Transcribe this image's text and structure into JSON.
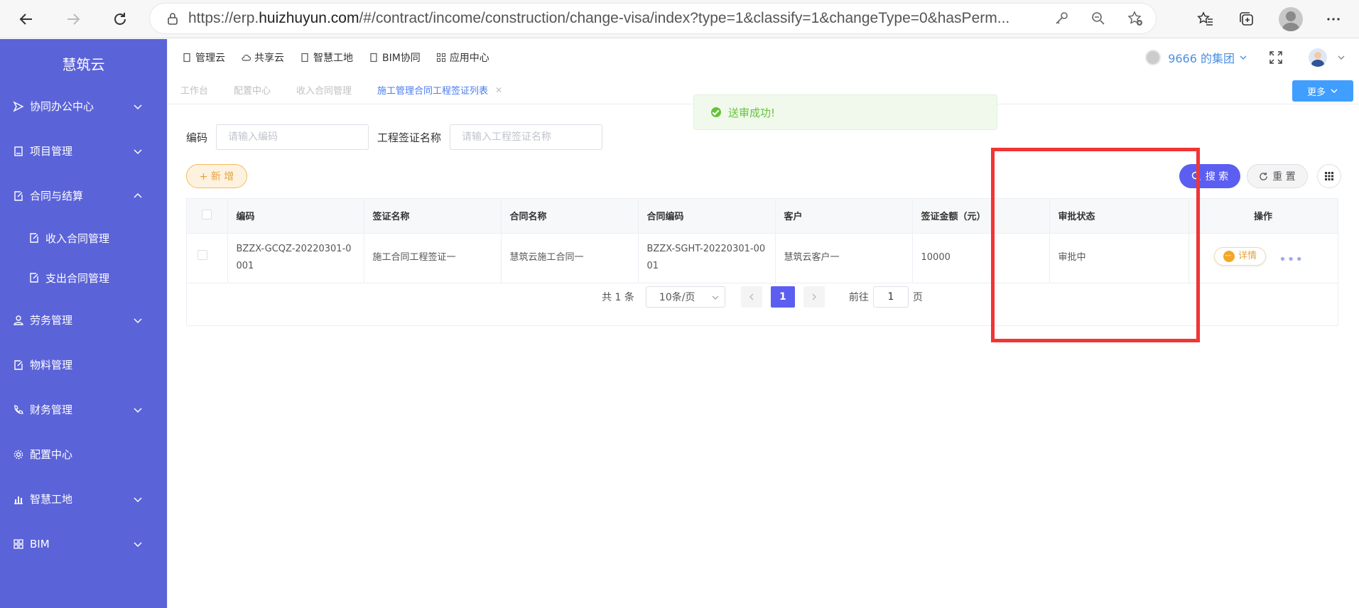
{
  "browser": {
    "url_prefix": "https://erp.",
    "url_domain": "huizhuyun.com",
    "url_rest": "/#/contract/income/construction/change-visa/index?type=1&classify=1&changeType=0&hasPerm..."
  },
  "sidebar": {
    "brand": "慧筑云",
    "items": [
      {
        "label": "协同办公中心"
      },
      {
        "label": "项目管理"
      },
      {
        "label": "合同与结算"
      },
      {
        "label": "收入合同管理"
      },
      {
        "label": "支出合同管理"
      },
      {
        "label": "劳务管理"
      },
      {
        "label": "物料管理"
      },
      {
        "label": "财务管理"
      },
      {
        "label": "配置中心"
      },
      {
        "label": "智慧工地"
      },
      {
        "label": "BIM"
      }
    ]
  },
  "topnav": {
    "items": [
      {
        "label": "管理云"
      },
      {
        "label": "共享云"
      },
      {
        "label": "智慧工地"
      },
      {
        "label": "BIM协同"
      },
      {
        "label": "应用中心"
      }
    ],
    "group": "9666 的集团"
  },
  "tabs": [
    {
      "label": "工作台"
    },
    {
      "label": "配置中心"
    },
    {
      "label": "收入合同管理"
    },
    {
      "label": "施工管理合同工程签证列表"
    }
  ],
  "more_label": "更多",
  "toast": {
    "message": "送审成功!"
  },
  "filters": {
    "code_label": "编码",
    "code_placeholder": "请输入编码",
    "name_label": "工程签证名称",
    "name_placeholder": "请输入工程签证名称"
  },
  "buttons": {
    "add": "+ 新 增",
    "search": "搜 索",
    "reset": "重 置"
  },
  "table": {
    "headers": [
      "编码",
      "签证名称",
      "合同名称",
      "合同编码",
      "客户",
      "签证金额（元）",
      "审批状态",
      "操作"
    ],
    "rows": [
      {
        "code": "BZZX-GCQZ-20220301-0001",
        "visa_name": "施工合同工程签证一",
        "contract_name": "慧筑云施工合同一",
        "contract_code": "BZZX-SGHT-20220301-0001",
        "customer": "慧筑云客户一",
        "amount": "10000",
        "status": "审批中",
        "action": "详情"
      }
    ]
  },
  "pagination": {
    "total": "共 1 条",
    "page_size": "10条/页",
    "current": "1",
    "goto_label": "前往",
    "goto_value": "1",
    "page_suffix": "页"
  }
}
